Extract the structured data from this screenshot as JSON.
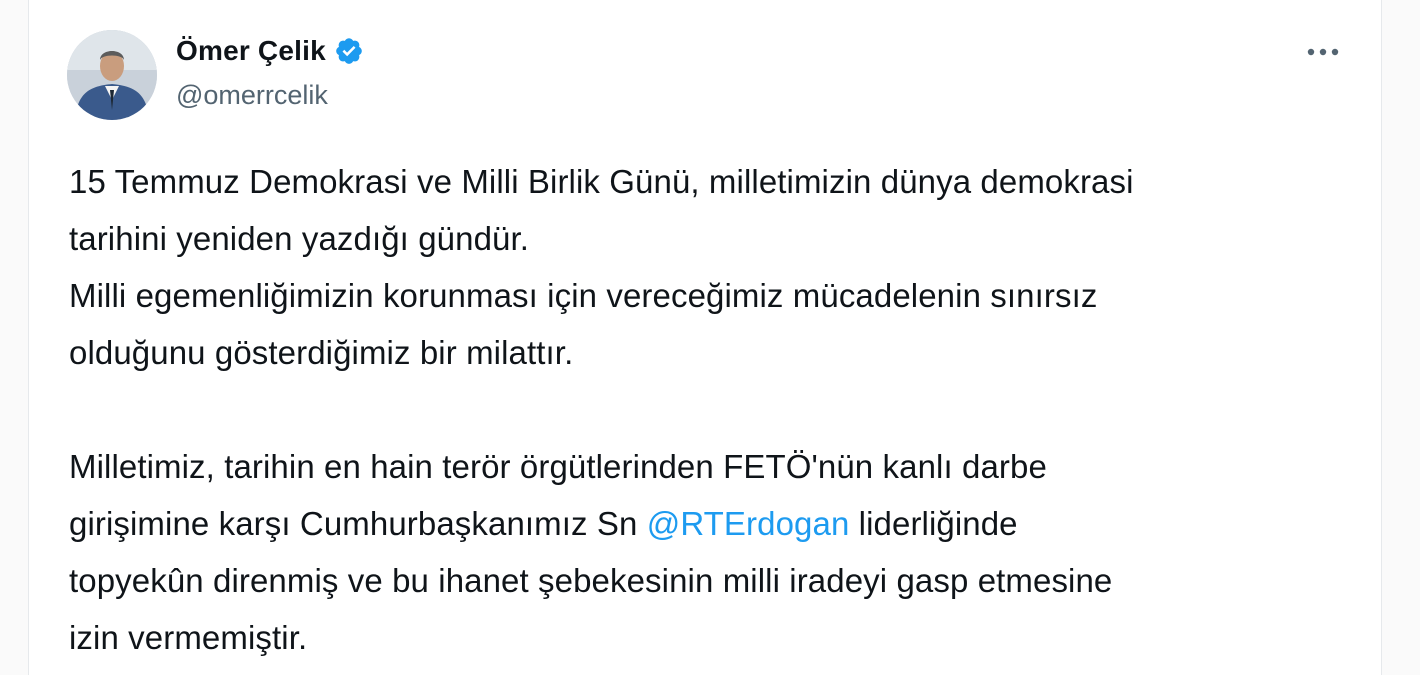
{
  "author": {
    "display_name": "Ömer Çelik",
    "handle": "@omerrcelik",
    "verified_icon": "verified-badge-icon",
    "avatar_icon": "profile-photo"
  },
  "menu": {
    "more_icon": "more-horizontal-icon"
  },
  "tweet": {
    "paragraph1_line1": "15 Temmuz Demokrasi ve Milli Birlik Günü, milletimizin dünya demokrasi",
    "paragraph1_line2": "tarihini yeniden yazdığı gündür.",
    "paragraph2_line1": "Milli egemenliğimizin korunması için vereceğimiz mücadelenin sınırsız",
    "paragraph2_line2": "olduğunu gösterdiğimiz bir milattır.",
    "paragraph3_line1": "Milletimiz, tarihin en hain terör örgütlerinden FETÖ'nün kanlı darbe",
    "paragraph3_line2_before": "girişimine karşı Cumhurbaşkanımız Sn ",
    "mention": "@RTErdogan",
    "paragraph3_line2_after": " liderliğinde",
    "paragraph3_line3": "topyekûn direnmiş ve bu ihanet şebekesinin milli iradeyi gasp etmesine",
    "paragraph3_line4": "izin vermemiştir."
  },
  "colors": {
    "text": "#0f1419",
    "secondary": "#536471",
    "accent": "#1d9bf0"
  }
}
